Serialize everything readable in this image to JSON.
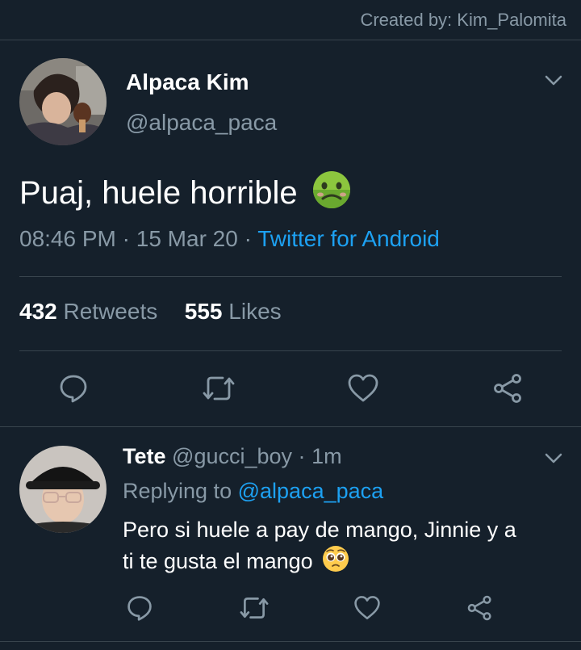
{
  "header": {
    "credit": "Created by: Kim_Palomita"
  },
  "main_tweet": {
    "display_name": "Alpaca Kim",
    "handle": "@alpaca_paca",
    "text": "Puaj, huele horrible",
    "emoji_icon": "nauseated-face-icon",
    "time": "08:46 PM",
    "sep1": "·",
    "date": "15 Mar 20",
    "sep2": "·",
    "source": "Twitter for Android",
    "retweets_count": "432",
    "retweets_label": "Retweets",
    "likes_count": "555",
    "likes_label": "Likes",
    "actions": [
      "reply-icon",
      "retweet-icon",
      "like-icon",
      "share-icon"
    ]
  },
  "reply_tweet": {
    "display_name": "Tete",
    "handle": "@gucci_boy",
    "sep": "·",
    "time": "1m",
    "replying_label": "Replying to",
    "replying_handle": "@alpaca_paca",
    "text_line1": "Pero si huele a pay de mango, Jinnie y a",
    "text_line2": "ti te gusta el mango",
    "emoji_icon": "pleading-face-icon",
    "actions": [
      "reply-icon",
      "retweet-icon",
      "like-icon",
      "share-icon"
    ]
  },
  "colors": {
    "background": "#15202b",
    "muted": "#8899a6",
    "link": "#1da1f2",
    "divider": "#38444d"
  }
}
